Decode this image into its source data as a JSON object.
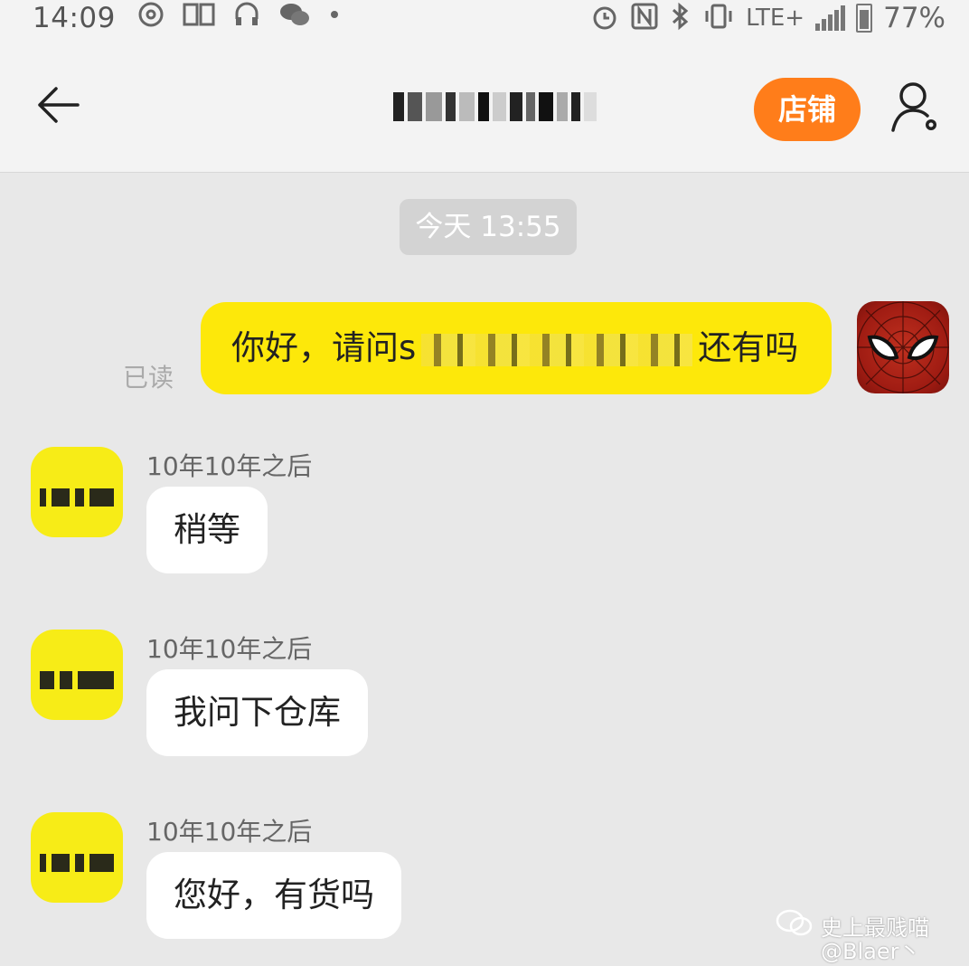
{
  "status_bar": {
    "time": "14:09",
    "lte": "LTE+",
    "battery": "77%",
    "icons": [
      "netease-music-icon",
      "mail-icon",
      "headphones-icon",
      "wechat-icon",
      "alarm-icon",
      "nfc-icon",
      "bluetooth-icon",
      "vibrate-icon",
      "signal-icon",
      "battery-icon"
    ]
  },
  "header": {
    "shop_label": "店铺"
  },
  "chat": {
    "date_chip": "今天 13:55",
    "my_message": {
      "text_start": "你好，请问s",
      "text_end": "还有吗",
      "read_status": "已读"
    },
    "incoming": [
      {
        "stamp": "10年10年之后",
        "text": "稍等"
      },
      {
        "stamp": "10年10年之后",
        "text": "我问下仓库"
      },
      {
        "stamp": "10年10年之后",
        "text": "您好，有货吗"
      }
    ]
  },
  "watermark": {
    "line1": "史上最贱喵",
    "line2": "@Blaer丶"
  },
  "colors": {
    "accent_orange": "#ff7d1a",
    "my_bubble_yellow": "#fde80a",
    "chat_background": "#e8e8e8"
  }
}
